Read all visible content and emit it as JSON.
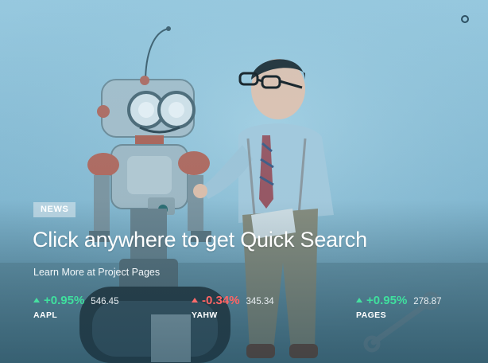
{
  "badge": {
    "label": "NEWS"
  },
  "headline": "Click anywhere to get Quick Search",
  "subline": "Learn More at Project Pages",
  "tickers": [
    {
      "change": "+0.95%",
      "price": "546.45",
      "symbol": "AAPL",
      "direction": "up",
      "color": "#3fe09e"
    },
    {
      "change": "-0.34%",
      "price": "345.34",
      "symbol": "YAHW",
      "direction": "up",
      "color": "#ff6464"
    },
    {
      "change": "+0.95%",
      "price": "278.87",
      "symbol": "PAGES",
      "direction": "up",
      "color": "#3fe09e"
    }
  ],
  "icons": {
    "corner": "circle-icon",
    "up": "triangle-up-icon"
  }
}
